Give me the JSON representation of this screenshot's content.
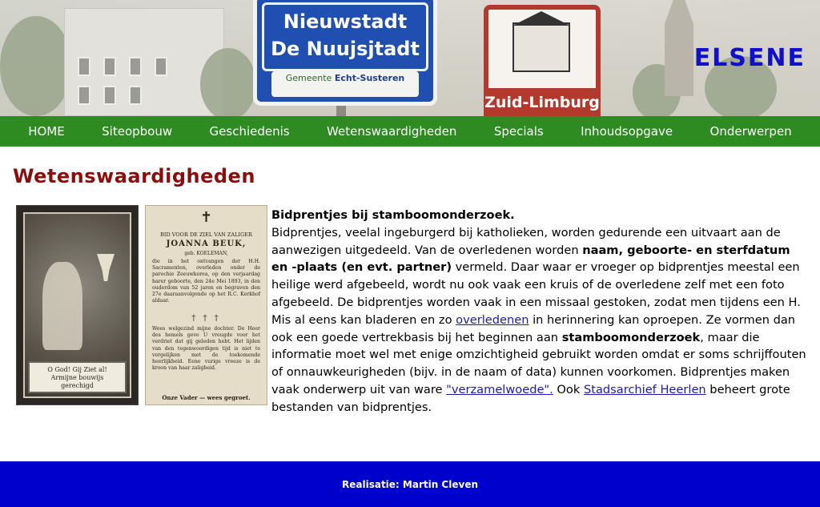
{
  "header": {
    "site_title": "ELSENE",
    "banner": {
      "sign_blue_line1": "Nieuwstadt",
      "sign_blue_line2": "De Nuujsjtadt",
      "sign_blue_gemeente_prefix": "Gemeente",
      "sign_blue_gemeente_name": "Echt-Susteren",
      "sign_red_label": "Zuid-Limburg"
    }
  },
  "nav": {
    "items": [
      {
        "label": "HOME"
      },
      {
        "label": "Siteopbouw"
      },
      {
        "label": "Geschiedenis"
      },
      {
        "label": "Wetenswaardigheden"
      },
      {
        "label": "Specials"
      },
      {
        "label": "Inhoudsopgave"
      },
      {
        "label": "Onderwerpen"
      }
    ]
  },
  "main": {
    "heading": "Wetenswaardigheden",
    "images": {
      "card1_caption_line1": "O God! Gij Ziet al!",
      "card1_caption_line2": "Armijne bouwijs",
      "card1_caption_line3": "gerechigd",
      "card2_title": "BID VOOR DE ZIEL VAN ZALIGER",
      "card2_name": "JOANNA BEUK,",
      "card2_spouse": "geb. KOELEMAN,",
      "card2_body": "die in het ontvangen der H.H. Sacramenten, overleden onder de parochie Zeeuwkorea, op den verjaardag harer geboorte, den 24e Mei 1893, in den ouderdom van 52 jaren en begraven den 27e daaraanvolgende op het R.C. Kerkhof aldaar.",
      "card2_crosses": "† † †",
      "card2_body2": "Wees welgezind mijne dochter. De Heer des hemels geve U vreugde voor het verdriet dat gij geleden hebt. Het lijden van den tegenwoordigen tijd is niet te vergelijken met de toekomende heerlijkheid. Eene vurige vreeze is de kroon van haar zaligheid.",
      "card2_footer": "Onze Vader — wees gegroet."
    },
    "text": {
      "p_title": "Bidprentjes bij stamboomonderzoek.",
      "s1": "Bidprentjes, veelal ingeburgerd bij katholieken, worden gedurende een uitvaart aan de aanwezigen uitgedeeld. Van de overledenen worden ",
      "b1": "naam, geboorte- en sterfdatum en -plaats (en evt. partner)",
      "s2": " vermeld. Daar waar er vroeger op bidprentjes meestal een heilige werd afgebeeld, wordt nu ook vaak een kruis of de overledene zelf met een foto afgebeeld. De bidprentjes worden vaak in een missaal gestoken, zodat men tijdens een H. Mis al eens kan bladeren en zo ",
      "link1": "overledenen",
      "s3": " in herinnering kan oproepen. Ze vormen dan ook een goede vertrekbasis bij het beginnen aan ",
      "b2": "stamboomonderzoek",
      "s4": ", maar die informatie moet wel met enige omzichtigheid gebruikt worden omdat er soms schrijffouten of onnauwkeurigheden (bijv. in de naam of data) kunnen voorkomen. Bidprentjes maken vaak onderwerp uit van ware ",
      "link2": "\"verzamelwoede\".",
      "s5": " Ook ",
      "link3": "Stadsarchief Heerlen",
      "s6": " beheert grote bestanden van bidprentjes."
    }
  },
  "footer": {
    "credit": "Realisatie: Martin Cleven"
  },
  "colors": {
    "nav_bg": "#2e8b22",
    "heading": "#8b0d0d",
    "site_title": "#1010c8",
    "footer_bg": "#0000cc",
    "link": "#1a1ab8"
  }
}
